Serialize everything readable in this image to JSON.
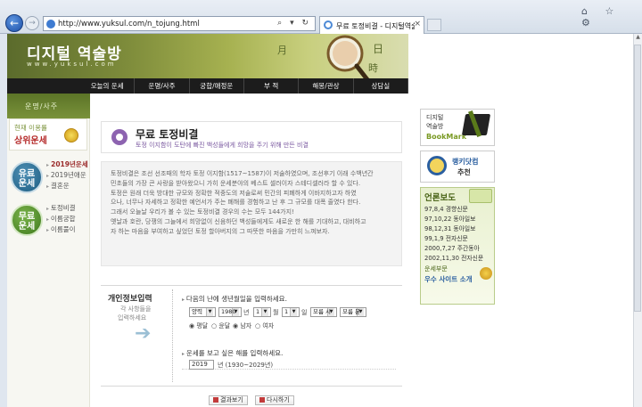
{
  "browser": {
    "url": "http://www.yuksul.com/n_tojung.html",
    "address_icons": "⌕ ▾ ↻",
    "tab_title": "무료 토정비결 - 디지털역술...",
    "tab_close": "×",
    "back": "←",
    "forward": "→",
    "chrome_icons": "⌂ ☆ ⚙"
  },
  "header": {
    "site_title": "디지털 역술방",
    "site_url": "www.yuksul.com",
    "moon": "月",
    "sun": "日",
    "time": "時",
    "nav": [
      "오늘의 운세",
      "운명/사주",
      "궁합/애정운",
      "부 적",
      "해몽/관상",
      "상담실"
    ]
  },
  "left": {
    "head_label": "운명/사주",
    "user_line1": "현재 이용률",
    "user_line2": "상위운세",
    "paid_badge": [
      "유료",
      "운세"
    ],
    "paid_links": [
      "2019년운세",
      "2019년애운",
      "결혼운"
    ],
    "free_badge": [
      "무료",
      "운세"
    ],
    "free_links": [
      "토정비결",
      "이름궁합",
      "이름풀이"
    ]
  },
  "main": {
    "title": "무료 토정비결",
    "subtitle": "토정 이지함이 도탄에 빠진 백성들에게 희망을 주기 위해 만든 비결",
    "description": [
      "토정비결은 조선 선조때의 학자 토정 이지함(1517~1587)이 저술하였으며, 조선후기 이래 수백년간",
      "민초들의 가장 큰 사랑을 받아왔으니 가히 운세분야의 베스트 셀러이자 스테디셀러라 할 수 있다.",
      "토정은 원래 더욱 방대한 규모와 정확한 적중도의 저술로써 민간의 피폐하게 이바지하고자 하였",
      "으나, 너무나 자세하고 정확한 예언서가 주는 폐해를 경험하고 난 후 그 규모를 대폭 줄였다 한다.",
      "그래서 오늘날 우리가 볼 수 있는 토정비결 경우의 수는 모두 144가지!",
      "옛날과 호란, 당쟁의 그늘에서 희망없이 신음하던 백성들에게도 새로운 한 해를 기대하고, 대비하고",
      "자 하는 마음을 부여하고 싶었던 토정 할아버지의 그 따뜻한 마음을 가만히 느껴보자."
    ]
  },
  "form": {
    "label": "개인정보입력",
    "hint1": "각 사항들을",
    "hint2": "입력하세요",
    "arrow": "➔",
    "q1": "다음의 난에 생년월일을 입력하세요.",
    "calendar": "양력",
    "year": "1980",
    "year_unit": "년",
    "month": "1",
    "month_unit": "월",
    "day": "1",
    "day_unit": "일",
    "hour": "모름 시",
    "minute": "모름 분",
    "leap_normal": "평달",
    "leap_yun": "윤달",
    "gender_male": "남자",
    "gender_female": "여자",
    "q2": "운세를 보고 싶은 해를 입력하세요.",
    "target_year": "2019",
    "target_hint": "년 (1930~2029년)",
    "submit": "결과보기",
    "reset": "다시하기"
  },
  "right": {
    "bookmark_t1": "디지털",
    "bookmark_t2": "역술방",
    "bookmark_en": "BookMark",
    "ranking_t1": "랭키닷컴",
    "ranking_t2": "추천",
    "press_title": "언론보도",
    "press_items": [
      "97,8,4 경향신문",
      "97,10,22 동아일보",
      "98,12,31 동아일보",
      "99,1,9 전자신문",
      "2000,7,27 주간동아",
      "2002,11,30 전자신문"
    ],
    "press_dept": "운세부문",
    "press_award": "우수 사이트 소개"
  }
}
